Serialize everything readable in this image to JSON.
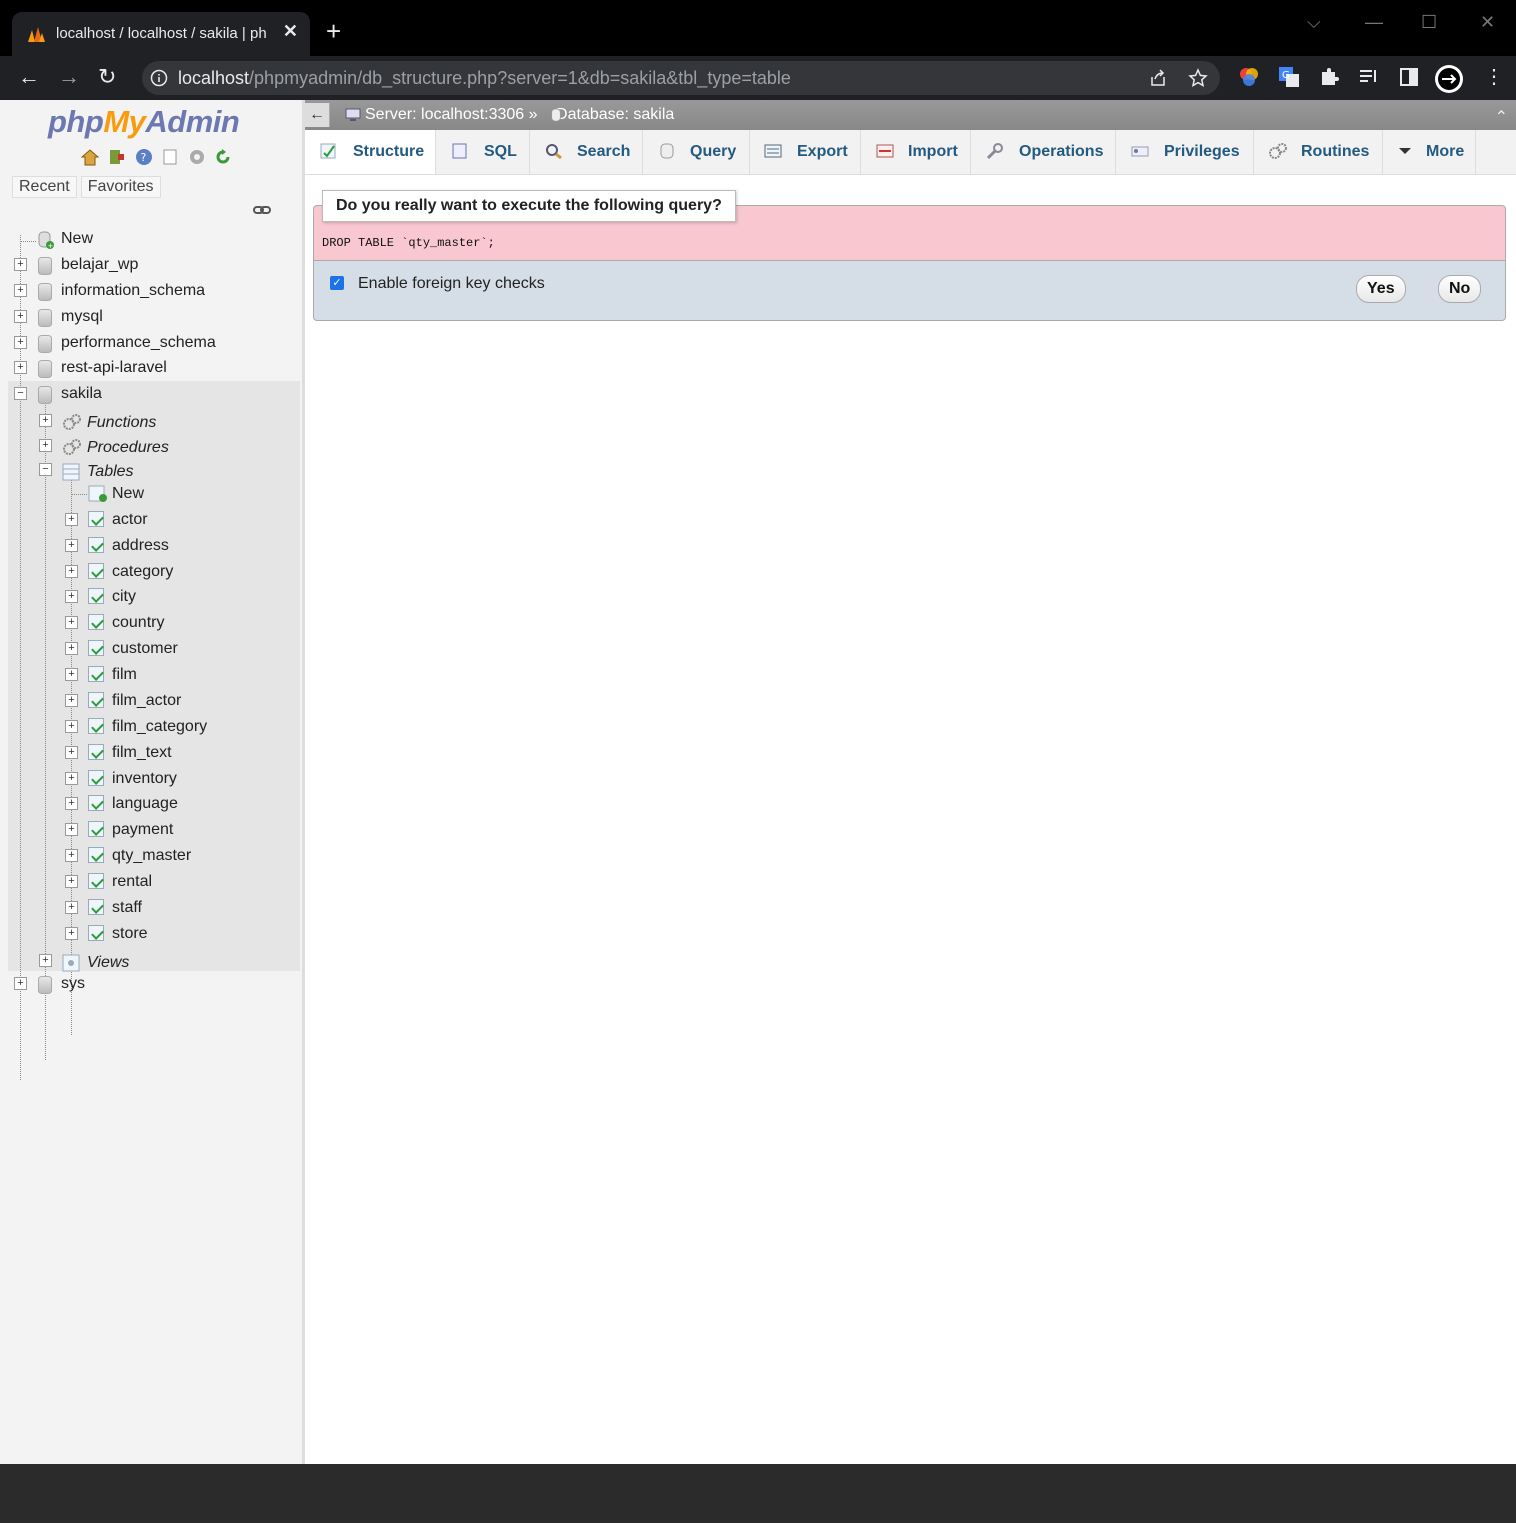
{
  "browser": {
    "tab_title": "localhost / localhost / sakila | php",
    "url_host": "localhost",
    "url_path": "/phpmyadmin/db_structure.php?server=1&db=sakila&tbl_type=table"
  },
  "nav": {
    "logo_php": "php",
    "logo_my": "My",
    "logo_admin": "Admin",
    "recent": "Recent",
    "favorites": "Favorites",
    "new_db": "New",
    "databases": [
      "belajar_wp",
      "information_schema",
      "mysql",
      "performance_schema",
      "rest-api-laravel",
      "sakila",
      "sys"
    ],
    "sakila": {
      "functions": "Functions",
      "procedures": "Procedures",
      "tables": "Tables",
      "new_table": "New",
      "table_list": [
        "actor",
        "address",
        "category",
        "city",
        "country",
        "customer",
        "film",
        "film_actor",
        "film_category",
        "film_text",
        "inventory",
        "language",
        "payment",
        "qty_master",
        "rental",
        "staff",
        "store"
      ],
      "views": "Views"
    }
  },
  "breadcrumb": {
    "server": "Server: localhost:3306",
    "separator": "»",
    "database": "Database: sakila"
  },
  "tabs": [
    "Structure",
    "SQL",
    "Search",
    "Query",
    "Export",
    "Import",
    "Operations",
    "Privileges",
    "Routines",
    "More"
  ],
  "dialog": {
    "title": "Do you really want to execute the following query?",
    "query": "DROP TABLE `qty_master`;",
    "fk_label": "Enable foreign key checks",
    "fk_checked": true,
    "yes": "Yes",
    "no": "No"
  },
  "colors": {
    "accent_link": "#235a81",
    "dialog_warning_bg": "#f8c7d0",
    "logo_orange": "#f89c0e",
    "logo_blue": "#6c78af"
  }
}
